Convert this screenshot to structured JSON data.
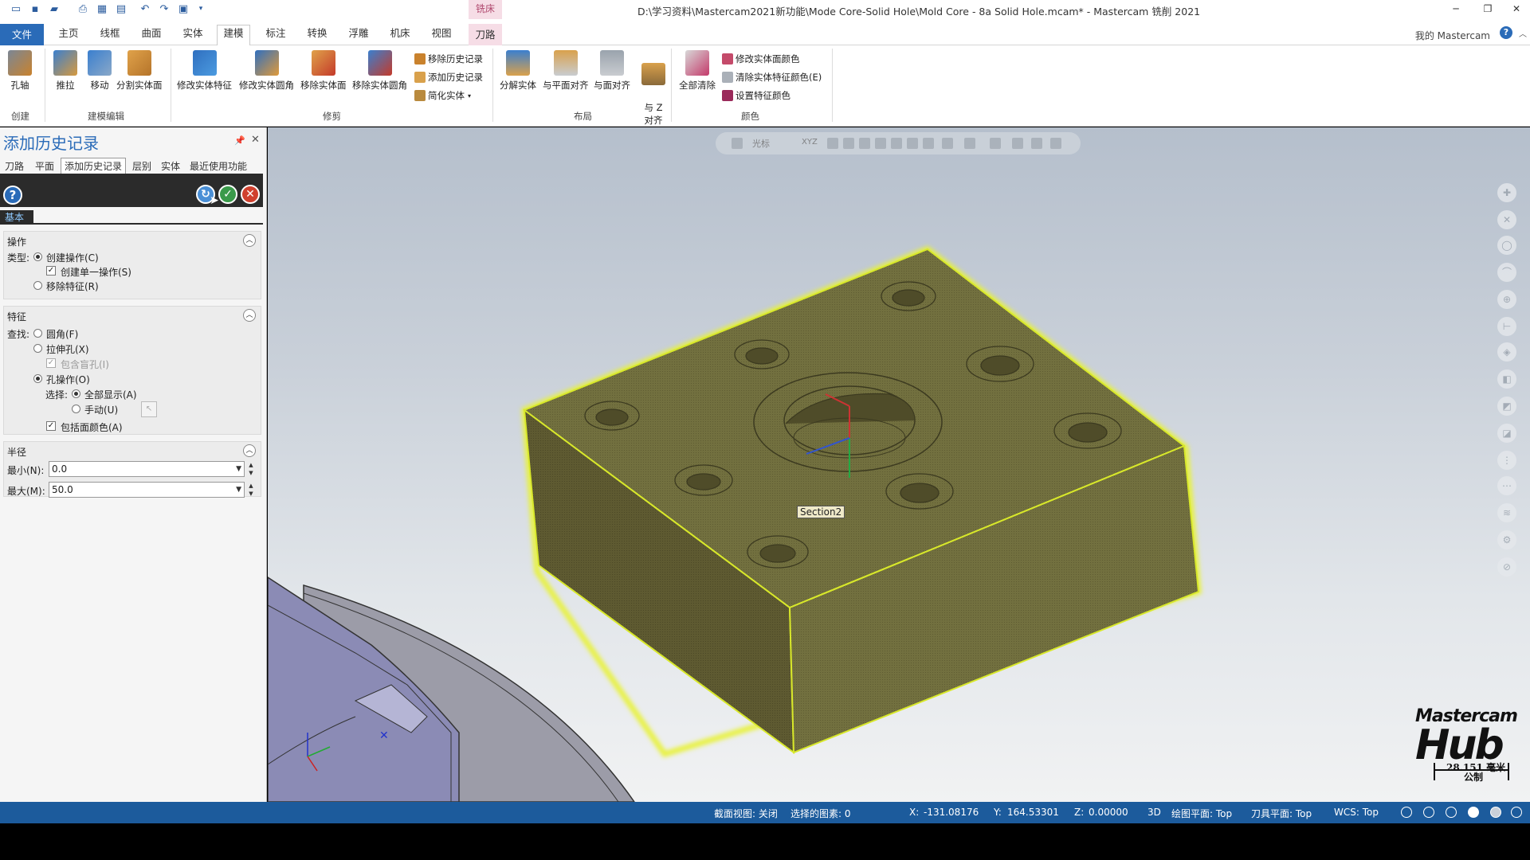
{
  "titlebar": {
    "title": "D:\\学习资料\\Mastercam2021新功能\\Mode Core-Solid Hole\\Mold Core - 8a Solid Hole.mcam* - Mastercam 铣削 2021",
    "context_tab": "铣床"
  },
  "tabs": {
    "file": "文件",
    "home": "主页",
    "wireframe": "线框",
    "surfaces": "曲面",
    "solids": "实体",
    "model": "建模",
    "annotate": "标注",
    "transform": "转换",
    "emboss": "浮雕",
    "machine": "机床",
    "view": "视图",
    "toolpaths": "刀路",
    "my_mastercam": "我的 Mastercam",
    "help": "?"
  },
  "ribbon": {
    "create_group": "创建",
    "hole_axis": "孔轴",
    "model_edit_group": "建模编辑",
    "push_pull": "推拉",
    "move": "移动",
    "split_face": "分割实体面",
    "trim_group": "修剪",
    "modify_feature": "修改实体特征",
    "modify_fillet": "修改实体圆角",
    "remove_face": "移除实体面",
    "remove_fillet": "移除实体圆角",
    "remove_history": "移除历史记录",
    "add_history": "添加历史记录",
    "simplify_solid": "简化实体",
    "layout_group": "布局",
    "disassemble": "分解实体",
    "align_plane": "与平面对齐",
    "align_face": "与面对齐",
    "align_z": "与 Z\n对齐",
    "color_group": "颜色",
    "clear_all": "全部清除",
    "modify_face_color": "修改实体面颜色",
    "clear_feature_color": "清除实体特征颜色(E)",
    "set_feature_color": "设置特征颜色"
  },
  "panel": {
    "title": "添加历史记录",
    "tabs": [
      "刀路",
      "平面",
      "添加历史记录",
      "层别",
      "实体",
      "最近使用功能"
    ],
    "basic_tab": "基本",
    "operation": {
      "title": "操作",
      "type_label": "类型:",
      "create_op": "创建操作(C)",
      "create_single": "创建单一操作(S)",
      "remove_feature": "移除特征(R)"
    },
    "feature": {
      "title": "特征",
      "find_label": "查找:",
      "fillet": "圆角(F)",
      "extrude_hole": "拉伸孔(X)",
      "include_blind": "包含盲孔(I)",
      "hole_op": "孔操作(O)",
      "select_label": "选择:",
      "show_all": "全部显示(A)",
      "manual": "手动(U)",
      "include_face_color": "包括面颜色(A)"
    },
    "radius": {
      "title": "半径",
      "min_label": "最小(N):",
      "min_value": "0.0",
      "max_label": "最大(M):",
      "max_value": "50.0"
    }
  },
  "viewport": {
    "toolbar_cursor": "光标",
    "toolbar_xyz": "XYZ",
    "section_label": "Section2",
    "logo_line1": "Mastercam",
    "logo_line2": "Hub",
    "scale_value": "28.151 毫米",
    "scale_unit": "公制",
    "part_color": "#6f6a3c",
    "highlight_color": "#e8f23a"
  },
  "statusbar": {
    "section_view": "截面视图: 关闭",
    "selected": "选择的图素: 0",
    "x_label": "X:",
    "x_value": "-131.08176",
    "y_label": "Y:",
    "y_value": "164.53301",
    "z_label": "Z:",
    "z_value": "0.00000",
    "mode": "3D",
    "cplane": "绘图平面: Top",
    "tplane": "刀具平面: Top",
    "wcs": "WCS: Top"
  }
}
